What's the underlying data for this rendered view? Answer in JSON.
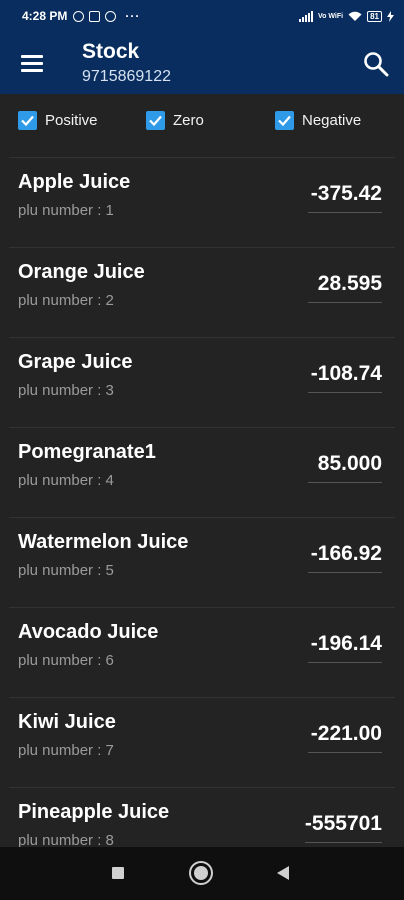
{
  "status_bar": {
    "time": "4:28 PM",
    "dots": "···",
    "network": "Vo WiFi",
    "battery": "81"
  },
  "app_bar": {
    "title": "Stock",
    "subtitle": "9715869122",
    "menu_icon": "hamburger-menu-icon",
    "search_icon": "search-icon"
  },
  "filters": [
    {
      "label": "Positive",
      "checked": true
    },
    {
      "label": "Zero",
      "checked": true
    },
    {
      "label": "Negative",
      "checked": true
    }
  ],
  "items": [
    {
      "name": "Apple Juice",
      "plu": "plu number : 1",
      "qty": "-375.42"
    },
    {
      "name": "Orange Juice",
      "plu": "plu number : 2",
      "qty": "28.595"
    },
    {
      "name": "Grape Juice",
      "plu": "plu number : 3",
      "qty": "-108.74"
    },
    {
      "name": "Pomegranate1",
      "plu": "plu number : 4",
      "qty": "85.000"
    },
    {
      "name": "Watermelon Juice",
      "plu": "plu number : 5",
      "qty": "-166.92"
    },
    {
      "name": "Avocado Juice",
      "plu": "plu number : 6",
      "qty": "-196.14"
    },
    {
      "name": "Kiwi Juice",
      "plu": "plu number : 7",
      "qty": "-221.00"
    },
    {
      "name": "Pineapple Juice",
      "plu": "plu number : 8",
      "qty": "-555701"
    }
  ],
  "colors": {
    "app_bar": "#082d5e",
    "background": "#232323",
    "checkbox": "#2f9be8"
  }
}
